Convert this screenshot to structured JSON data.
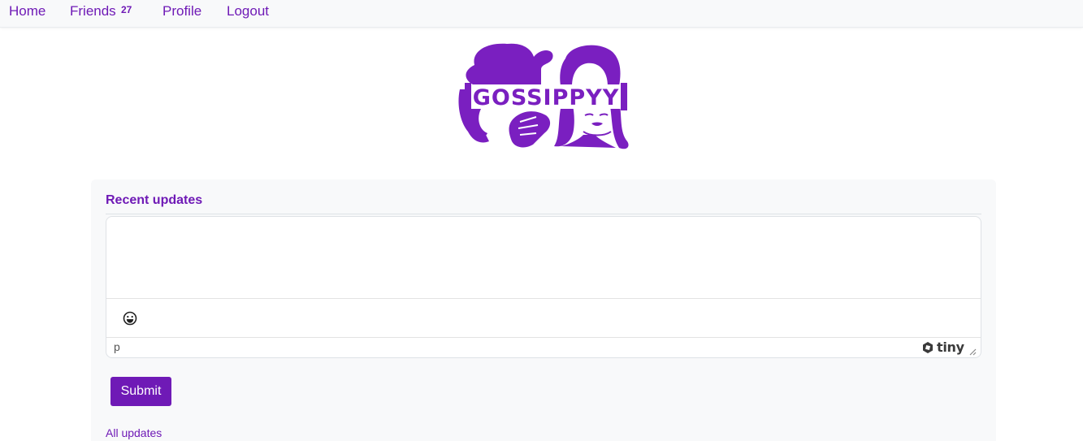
{
  "nav": {
    "home": "Home",
    "friends": "Friends",
    "friends_count": "27",
    "profile": "Profile",
    "logout": "Logout"
  },
  "logo": {
    "text": "GOSSIPPYY",
    "color": "#7a1fc0"
  },
  "card": {
    "title": "Recent updates",
    "editor": {
      "content": "",
      "toolbar_icons": [
        "emoji-icon"
      ],
      "status_path": "p",
      "brand": "tiny"
    },
    "submit_label": "Submit",
    "all_updates_link": "All updates"
  },
  "colors": {
    "accent": "#6f1ab6",
    "navbar_bg": "#f8f9fa",
    "card_bg": "#f8f9fa"
  }
}
